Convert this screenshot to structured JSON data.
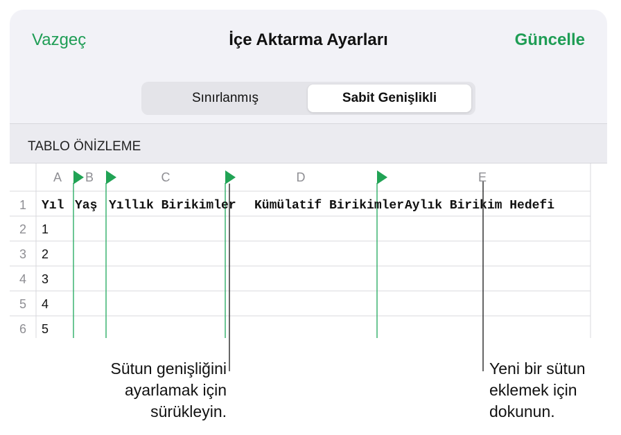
{
  "nav": {
    "cancel_label": "Vazgeç",
    "title": "İçe Aktarma Ayarları",
    "update_label": "Güncelle"
  },
  "segmented": {
    "options": [
      "Sınırlanmış",
      "Sabit Genişlikli"
    ],
    "selected": "Sabit Genişlikli"
  },
  "section": {
    "title": "TABLO ÖNİZLEME"
  },
  "columns": [
    "A",
    "B",
    "C",
    "D",
    "E"
  ],
  "row_numbers": [
    "1",
    "2",
    "3",
    "4",
    "5",
    "6"
  ],
  "header_row": [
    "Yıl",
    "Yaş",
    "Yıllık Birikimler",
    "Kümülatif Birikimler",
    "Aylık Birikim Hedefi"
  ],
  "data_rows": [
    "1",
    "2",
    "3",
    "4",
    "5"
  ],
  "callouts": {
    "drag": [
      "Sütun genişliğini",
      "ayarlamak için",
      "sürükleyin."
    ],
    "tap": [
      "Yeni bir sütun",
      "eklemek için",
      "dokunun."
    ]
  },
  "colors": {
    "accent": "#1f9d55",
    "marker": "#21a355",
    "divider": "#3cb371"
  }
}
